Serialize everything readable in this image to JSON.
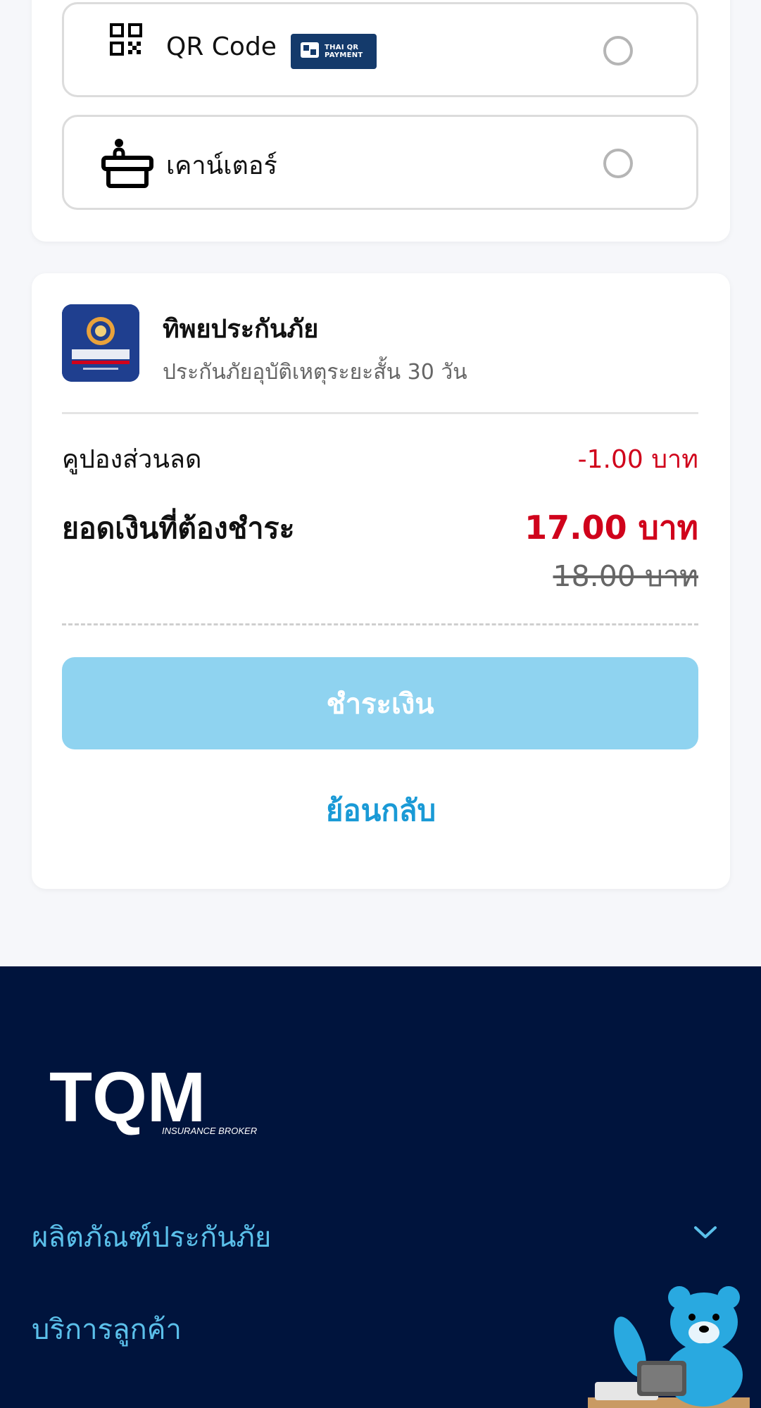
{
  "payment_methods": {
    "qr": {
      "label": "QR Code",
      "badge": "THAI QR PAYMENT",
      "badge_line1": "THAI QR",
      "badge_line2": "PAYMENT"
    },
    "counter": {
      "label": "เคาน์เตอร์"
    }
  },
  "summary": {
    "insurer_name": "ทิพยประกันภัย",
    "product_desc": "ประกันภัยอุบัติเหตุระยะสั้น 30 วัน",
    "coupon_label": "คูปองส่วนลด",
    "coupon_value": "-1.00 บาท",
    "total_label": "ยอดเงินที่ต้องชำระ",
    "total_value": "17.00 บาท",
    "original_value": "18.00 บาท",
    "pay_button": "ชำระเงิน",
    "back_link": "ย้อนกลับ"
  },
  "footer": {
    "logo_text": "TQM",
    "logo_sub": "INSURANCE BROKER",
    "menu": [
      "ผลิตภัณฑ์ประกันภัย",
      "บริการลูกค้า"
    ]
  },
  "colors": {
    "price_red": "#d0021b",
    "accent_blue": "#1a9ad6",
    "button_disabled": "#8fd3f0",
    "footer_bg": "#00143d"
  }
}
